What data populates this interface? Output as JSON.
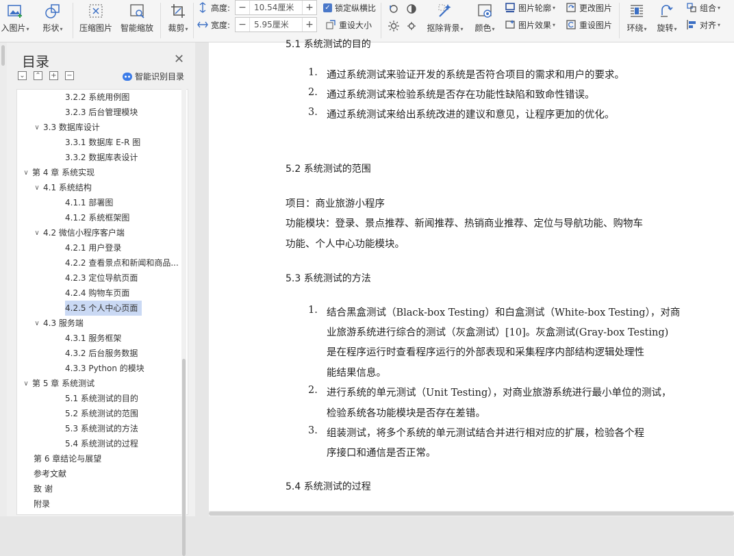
{
  "ribbon": {
    "insert_image_label": "入图片",
    "shape_label": "形状",
    "compress_label": "压缩图片",
    "smart_zoom_label": "智能缩放",
    "crop_label": "裁剪",
    "height_label": "高度:",
    "height_value": "10.54厘米",
    "width_label": "宽度:",
    "width_value": "5.95厘米",
    "lock_ratio_label": "锁定纵横比",
    "reset_size_label": "重设大小",
    "remove_bg_label": "抠除背景",
    "color_label": "颜色",
    "outline_label": "图片轮廓",
    "effect_label": "图片效果",
    "change_image_label": "更改图片",
    "reset_image_label": "重设图片",
    "wrap_label": "环绕",
    "rotate_label": "旋转",
    "group_label": "组合",
    "align_label": "对齐",
    "minus": "−",
    "plus": "+"
  },
  "toc": {
    "title": "目录",
    "smart_label": "智能识别目录",
    "items": [
      {
        "text": "3.2.2 系统用例图",
        "level": 3
      },
      {
        "text": "3.2.3 后台管理模块",
        "level": 3
      },
      {
        "text": "3.3 数据库设计",
        "level": 2,
        "expanded": true
      },
      {
        "text": "3.3.1 数据库 E-R 图",
        "level": 3
      },
      {
        "text": "3.3.2 数据库表设计",
        "level": 3
      },
      {
        "text": "第 4 章 系统实现",
        "level": 1,
        "expanded": true
      },
      {
        "text": "4.1 系统结构",
        "level": 2,
        "expanded": true
      },
      {
        "text": "4.1.1 部署图",
        "level": 3
      },
      {
        "text": "4.1.2 系统框架图",
        "level": 3
      },
      {
        "text": "4.2 微信小程序客户端",
        "level": 2,
        "expanded": true
      },
      {
        "text": "4.2.1 用户登录",
        "level": 3
      },
      {
        "text": "4.2.2 查看景点和新闻和商品...",
        "level": 3
      },
      {
        "text": "4.2.3 定位导航页面",
        "level": 3
      },
      {
        "text": "4.2.4 购物车页面",
        "level": 3
      },
      {
        "text": "4.2.5 个人中心页面",
        "level": 3,
        "selected": true
      },
      {
        "text": "4.3 服务端",
        "level": 2,
        "expanded": true
      },
      {
        "text": "4.3.1 服务框架",
        "level": 3
      },
      {
        "text": "4.3.2 后台服务数据",
        "level": 3
      },
      {
        "text": "4.3.3 Python 的模块",
        "level": 3
      },
      {
        "text": "第 5 章 系统测试",
        "level": 1,
        "expanded": true
      },
      {
        "text": "5.1 系统测试的目的",
        "level": 3
      },
      {
        "text": "5.2 系统测试的范围",
        "level": 3
      },
      {
        "text": "5.3 系统测试的方法",
        "level": 3
      },
      {
        "text": "5.4 系统测试的过程",
        "level": 3
      },
      {
        "text": "第 6 章结论与展望",
        "level": 0
      },
      {
        "text": "参考文献",
        "level": 0
      },
      {
        "text": "致 谢",
        "level": 0
      },
      {
        "text": "附录",
        "level": 0
      }
    ]
  },
  "doc": {
    "goals": [
      "通过系统测试来验证开发的系统是否符合项目的需求和用户的要求。",
      "通过系统测试来检验系统是否存在功能性缺陷和致命性错误。",
      "通过系统测试来给出系统改进的建议和意见，让程序更加的优化。"
    ],
    "h52": "5.2 系统测试的范围",
    "project_line": "项目：商业旅游小程序",
    "modules_line1": "功能模块：登录、景点推荐、新闻推荐、热销商业推荐、定位与导航功能、购物车",
    "modules_line2": "功能、个人中心功能模块。",
    "h53": "5.3 系统测试的方法",
    "methods": [
      {
        "n": "1.",
        "lines": [
          "结合黑盒测试（Black-box Testing）和白盒测试（White-box Testing），对商",
          "业旅游系统进行综合的测试（灰盒测试）[10]。灰盒测试(Gray-box Testing)",
          "是在程序运行时查看程序运行的外部表现和采集程序内部结构逻辑处理性",
          "能结果信息。"
        ]
      },
      {
        "n": "2.",
        "lines": [
          "进行系统的单元测试（Unit Testing），对商业旅游系统进行最小单位的测试，",
          "检验系统各功能模块是否存在差错。"
        ]
      },
      {
        "n": "3.",
        "lines": [
          "组装测试，将多个系统的单元测试结合并进行相对应的扩展，检验各个程",
          "序接口和通信是否正常。"
        ]
      }
    ],
    "h54": "5.4 系统测试的过程"
  }
}
